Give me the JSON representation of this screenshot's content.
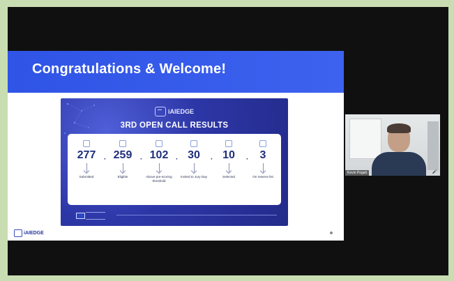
{
  "slide": {
    "title": "Congratulations & Welcome!",
    "card_brand": "iAIEDGE",
    "card_title": "3RD OPEN CALL RESULTS",
    "stats": [
      {
        "value": "277",
        "label": "Submitted"
      },
      {
        "value": "259",
        "label": "Eligible"
      },
      {
        "value": "102",
        "label": "Above pre-scoring threshold"
      },
      {
        "value": "30",
        "label": "Invited to Jury Day"
      },
      {
        "value": "10",
        "label": "Selected"
      },
      {
        "value": "3",
        "label": "On reserve list"
      }
    ],
    "separator": "·",
    "footer_brand": "iAIEDGE"
  },
  "participant": {
    "name": "Kevin Pegah",
    "mic_icon": "microphone-icon"
  },
  "colors": {
    "banner": "#2f54e6",
    "card": "#2d36a6",
    "number": "#1f2f7a",
    "background": "#c9ddb2"
  }
}
